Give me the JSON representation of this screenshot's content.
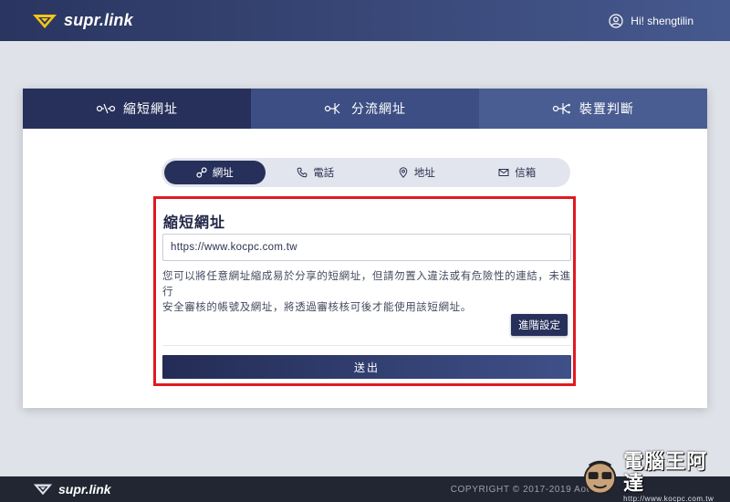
{
  "header": {
    "brand": "supr.link",
    "greeting": "Hi! shengtilin"
  },
  "tabs": [
    {
      "label": "縮短網址",
      "icon": "link-shorten-icon",
      "active": true
    },
    {
      "label": "分流網址",
      "icon": "split-icon",
      "active": false
    },
    {
      "label": "裝置判斷",
      "icon": "device-split-icon",
      "active": false
    }
  ],
  "pills": [
    {
      "label": "網址",
      "icon": "link-icon",
      "active": true
    },
    {
      "label": "電話",
      "icon": "phone-icon",
      "active": false
    },
    {
      "label": "地址",
      "icon": "map-pin-icon",
      "active": false
    },
    {
      "label": "信箱",
      "icon": "mail-icon",
      "active": false
    }
  ],
  "form": {
    "title": "縮短網址",
    "url_value": "https://www.kocpc.com.tw",
    "description_line1": "您可以將任意網址縮成易於分享的短網址，但請勿置入違法或有危險性的連結，未進行",
    "description_line2": "安全審核的帳號及網址，將透過審核核可後才能使用該短網址。",
    "advanced_label": "進階設定",
    "submit_label": "送出"
  },
  "footer": {
    "brand": "supr.link",
    "copyright": "COPYRIGHT © 2017-2019 Aot"
  },
  "watermark": {
    "title": "電腦王阿達",
    "url": "http://www.kocpc.com.tw"
  },
  "colors": {
    "accent": "#26305a",
    "highlight_border": "#e01a22",
    "logo_yellow": "#f5c518"
  }
}
